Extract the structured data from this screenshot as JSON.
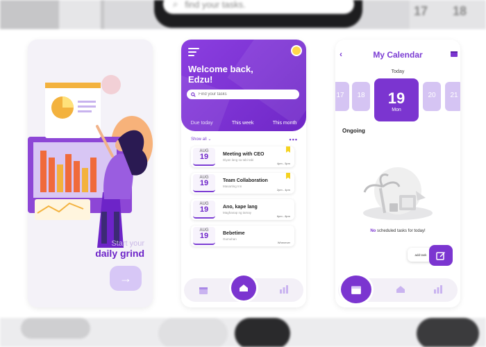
{
  "background": {
    "top_search_placeholder": "find your tasks.",
    "top_numbers": [
      "17",
      "18"
    ]
  },
  "onboarding": {
    "subtitle": "Start your",
    "title": "daily grind",
    "next_icon": "arrow-right-icon"
  },
  "home": {
    "greeting": "Welcome back, Edzu!",
    "search_placeholder": "Find your tasks",
    "tabs": [
      {
        "label": "Due today",
        "active": false
      },
      {
        "label": "This week",
        "active": true
      },
      {
        "label": "This month",
        "active": true
      }
    ],
    "show_all": "Show all",
    "more": "•••",
    "tasks": [
      {
        "month": "AUG",
        "day": "19",
        "title": "Meeting with CEO",
        "place": "Diyan lang sa tabi tabi",
        "time": "4pm - 5pm",
        "bookmarked": true
      },
      {
        "month": "AUG",
        "day": "19",
        "title": "Team Collaboration",
        "place": "Masarting Inn",
        "time": "2pm - 4pm",
        "bookmarked": true
      },
      {
        "month": "AUG",
        "day": "19",
        "title": "Ano, kape lang",
        "place": "Maghanap ng tamay",
        "time": "6pm - 8pm",
        "bookmarked": false
      },
      {
        "month": "AUG",
        "day": "19",
        "title": "Bebetime",
        "place": "Gumuhan",
        "time": "Whenever",
        "bookmarked": false
      }
    ],
    "colors": {
      "accent": "#7b35d0",
      "bookmark": "#f5d21f"
    }
  },
  "calendar": {
    "title": "My Calendar",
    "today_label": "Today",
    "days": [
      {
        "num": "17",
        "wd": "",
        "selected": false
      },
      {
        "num": "18",
        "wd": "",
        "selected": false
      },
      {
        "num": "19",
        "wd": "Mon",
        "selected": true
      },
      {
        "num": "20",
        "wd": "",
        "selected": false
      },
      {
        "num": "21",
        "wd": "",
        "selected": false
      }
    ],
    "ongoing_label": "Ongoing",
    "empty_bold": "No",
    "empty_text": " scheduled tasks for today!",
    "add_task_label": "add task"
  }
}
